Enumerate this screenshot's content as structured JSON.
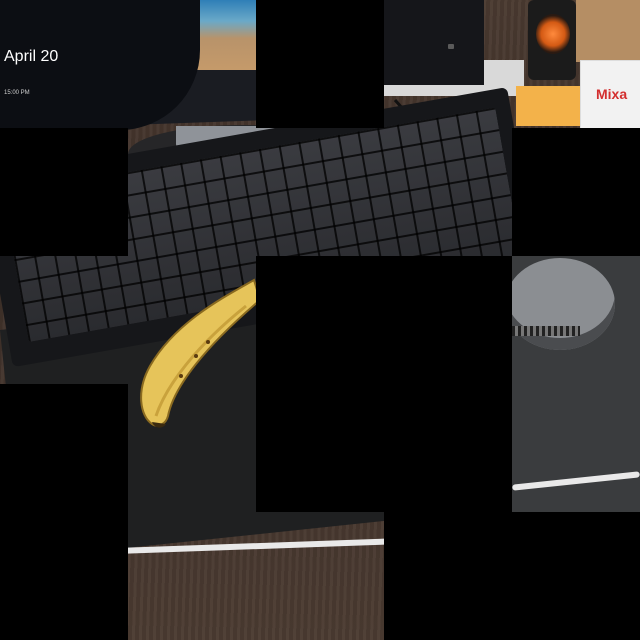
{
  "photo": {
    "subject": "desk",
    "lockscreen_date": "April 20",
    "lockscreen_time": "15:00 PM",
    "box_label": "Mixa"
  },
  "colors": {
    "banana": "#e6c45a",
    "desk": "#4a3a30",
    "mousepad": "#1f2021",
    "speaker_cone": "#ff8a3d",
    "box_label": "#d32f2f"
  }
}
